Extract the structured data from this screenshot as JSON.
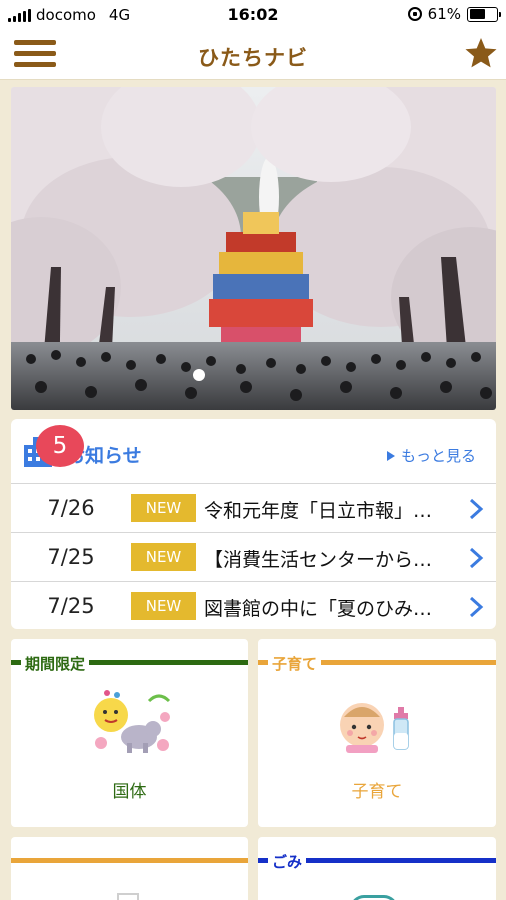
{
  "status_bar": {
    "carrier": "docomo",
    "network": "4G",
    "time": "16:02",
    "battery": "61%",
    "battery_level": 0.61
  },
  "header": {
    "title": "ひたちナビ",
    "menu_icon": "hamburger-menu-icon",
    "favorite_icon": "star-icon"
  },
  "news": {
    "badge_count": "5",
    "title": "お知らせ",
    "more_label": "もっと見る",
    "items": [
      {
        "date": "7/26",
        "tag": "NEW",
        "text": "令和元年度「日立市報」…"
      },
      {
        "date": "7/25",
        "tag": "NEW",
        "text": "【消費生活センターから…"
      },
      {
        "date": "7/25",
        "tag": "NEW",
        "text": "図書館の中に「夏のひみ…"
      }
    ]
  },
  "cards": [
    {
      "label": "期間限定",
      "caption": "国体",
      "color": "#2d6a12",
      "caption_color": "#2d6a12"
    },
    {
      "label": "子育て",
      "caption": "子育て",
      "color": "#e9a53a",
      "caption_color": "#e9a53a"
    },
    {
      "label": "",
      "caption": "",
      "color": "#e9a53a"
    },
    {
      "label": "ごみ",
      "caption": "",
      "color": "#1530c8"
    }
  ],
  "colors": {
    "brand_brown": "#8a5a19",
    "accent_blue": "#3b7be0",
    "badge_red": "#e8485a",
    "new_tag": "#e4b92e",
    "background": "#f1ead6"
  }
}
